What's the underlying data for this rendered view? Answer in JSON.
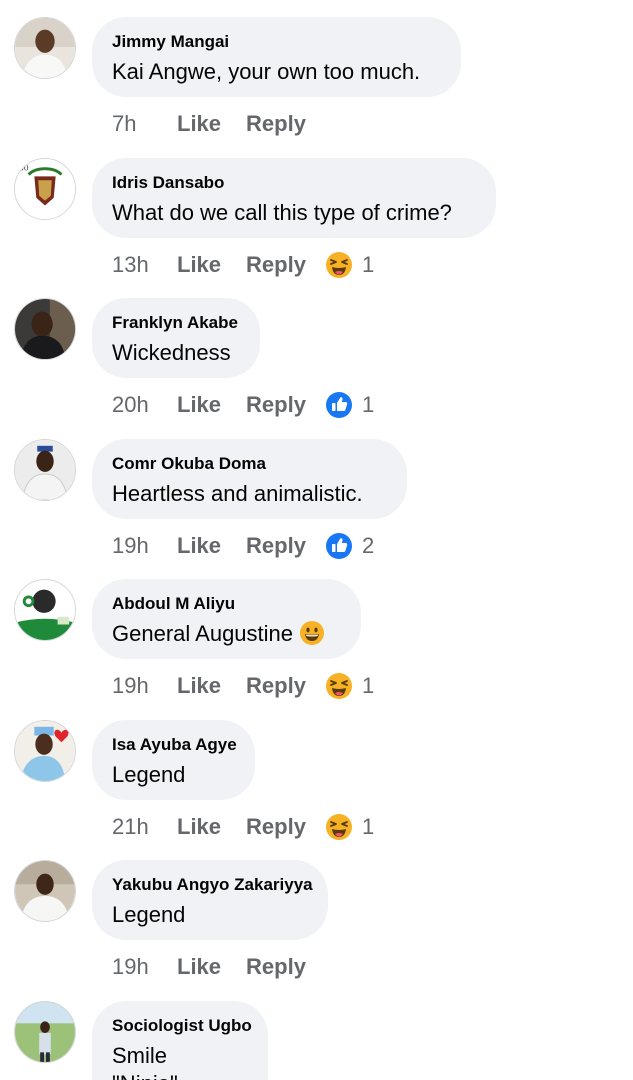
{
  "labels": {
    "like": "Like",
    "reply": "Reply"
  },
  "colors": {
    "bubble": "#f0f2f5",
    "meta_text": "#65676b",
    "like_blue": "#1877f2",
    "haha_yellow": "#f7b125"
  },
  "comments": [
    {
      "author": "Jimmy Mangai",
      "text": "Kai Angwe, your own too much.",
      "time": "7h",
      "reaction": null,
      "reaction_count": ""
    },
    {
      "author": "Idris Dansabo",
      "text": "What do we call this type of crime?",
      "time": "13h",
      "reaction": "haha-icon",
      "reaction_count": "1"
    },
    {
      "author": "Franklyn Akabe",
      "text": "Wickedness",
      "time": "20h",
      "reaction": "like-icon",
      "reaction_count": "1"
    },
    {
      "author": "Comr Okuba Doma",
      "text": "Heartless and animalistic.",
      "time": "19h",
      "reaction": "like-icon",
      "reaction_count": "2"
    },
    {
      "author": "Abdoul M Aliyu",
      "text": "General Augustine",
      "text_emoji": "smiley-emoji-icon",
      "time": "19h",
      "reaction": "haha-icon",
      "reaction_count": "1"
    },
    {
      "author": "Isa Ayuba Agye",
      "text": "Legend",
      "time": "21h",
      "reaction": "haha-icon",
      "reaction_count": "1"
    },
    {
      "author": "Yakubu Angyo Zakariyya",
      "text": "Legend",
      "time": "19h",
      "reaction": null,
      "reaction_count": ""
    },
    {
      "author": "Sociologist Ugbo",
      "text": "Smile",
      "text_line2": "\"Ninja\"",
      "time": "",
      "reaction": null,
      "reaction_count": ""
    }
  ]
}
